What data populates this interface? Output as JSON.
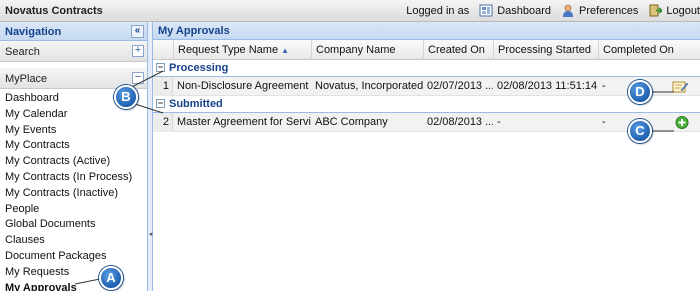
{
  "app": {
    "title": "Novatus Contracts"
  },
  "topbar": {
    "logged_in_label": "Logged in as",
    "dashboard_label": "Dashboard",
    "preferences_label": "Preferences",
    "logout_label": "Logout"
  },
  "nav": {
    "header": "Navigation",
    "collapse_glyph": "«",
    "search_label": "Search",
    "search_toggle": "+",
    "myplace_label": "MyPlace",
    "myplace_toggle": "−",
    "items": [
      "Dashboard",
      "My Calendar",
      "My Events",
      "My Contracts",
      "My Contracts (Active)",
      "My Contracts (In Process)",
      "My Contracts (Inactive)",
      "People",
      "Global Documents",
      "Clauses",
      "Document Packages",
      "My Requests",
      "My Approvals"
    ],
    "active_item": "My Approvals"
  },
  "main": {
    "title": "My Approvals",
    "columns": [
      "Request Type Name",
      "Company Name",
      "Created On",
      "Processing Started",
      "Completed On"
    ],
    "sorted_column": "Request Type Name",
    "sort_direction": "ascending",
    "groups": [
      {
        "label": "Processing",
        "rows": [
          {
            "num": "1",
            "request_type": "Non-Disclosure Agreement",
            "company": "Novatus, Incorporated",
            "created": "02/07/2013 ...",
            "processing": "02/08/2013 11:51:14",
            "completed": "-",
            "action_icon": "edit-note-icon"
          }
        ]
      },
      {
        "label": "Submitted",
        "rows": [
          {
            "num": "2",
            "request_type": "Master Agreement for Services",
            "company": "ABC Company",
            "created": "02/08/2013 ...",
            "processing": "-",
            "completed": "-",
            "action_icon": "add-icon"
          }
        ]
      }
    ]
  },
  "callouts": {
    "a": "A",
    "b": "B",
    "c": "C",
    "d": "D"
  },
  "colors": {
    "accent": "#15428b",
    "header_bg": "#c5d9f1",
    "callout": "#1f5fb0"
  }
}
